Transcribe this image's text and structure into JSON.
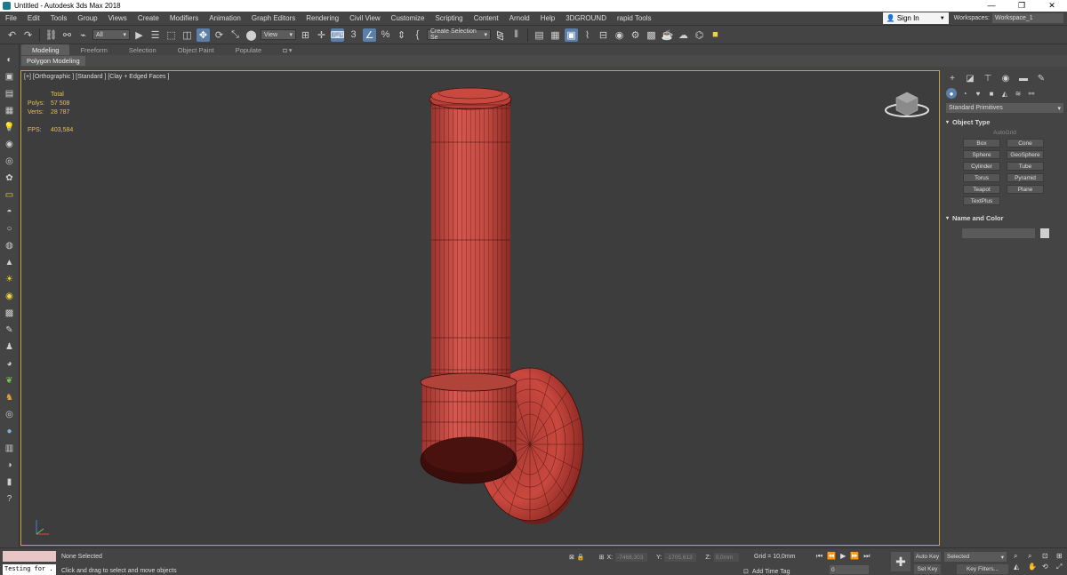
{
  "window": {
    "title": "Untitled - Autodesk 3ds Max 2018",
    "controls": [
      "—",
      "❐",
      "✕"
    ]
  },
  "menu": {
    "items": [
      "File",
      "Edit",
      "Tools",
      "Group",
      "Views",
      "Create",
      "Modifiers",
      "Animation",
      "Graph Editors",
      "Rendering",
      "Civil View",
      "Customize",
      "Scripting",
      "Content",
      "Arnold",
      "Help",
      "3DGROUND",
      "rapid Tools"
    ],
    "sign_in": "Sign In",
    "workspaces_label": "Workspaces:",
    "workspace_value": "Workspace_1"
  },
  "toolbar": {
    "filter_value": "All",
    "refcoord_value": "View",
    "selection_set_placeholder": "Create Selection Se",
    "snap_label": "3",
    "percent_label": "%"
  },
  "ribbon": {
    "tabs": [
      "Modeling",
      "Freeform",
      "Selection",
      "Object Paint",
      "Populate"
    ],
    "subtitle": "Polygon Modeling"
  },
  "viewport": {
    "label": "[+] [Orthographic ] [Standard ] [Clay + Edged Faces ]",
    "stats": {
      "header": "Total",
      "polys_label": "Polys:",
      "polys_value": "57 508",
      "verts_label": "Verts:",
      "verts_value": "28 787",
      "fps_label": "FPS:",
      "fps_value": "403,584"
    },
    "colors": {
      "model": "#c6473f",
      "model_dark": "#7a1f19",
      "wire": "#3b0d0a",
      "background": "#3d3d3d",
      "border_active": "#c9a13b"
    }
  },
  "command_panel": {
    "category": "Standard Primitives",
    "object_type_title": "Object Type",
    "autogrid": "AutoGrid",
    "objects": [
      "Box",
      "Cone",
      "Sphere",
      "GeoSphere",
      "Cylinder",
      "Tube",
      "Torus",
      "Pyramid",
      "Teapot",
      "Plane",
      "TextPlus"
    ],
    "name_color_title": "Name and Color"
  },
  "status": {
    "selection": "None Selected",
    "prompt": "Click and drag to select and move objects",
    "listener_text": "Testing for .",
    "x_label": "X:",
    "x_value": "-7468,303",
    "y_label": "Y:",
    "y_value": "-1705,613",
    "z_label": "Z:",
    "z_value": "0,0mm",
    "grid": "Grid = 10,0mm",
    "add_time_tag": "Add Time Tag",
    "frame": "0",
    "auto_key": "Auto Key",
    "set_key": "Set Key",
    "selected": "Selected",
    "key_filters": "Key Filters..."
  }
}
